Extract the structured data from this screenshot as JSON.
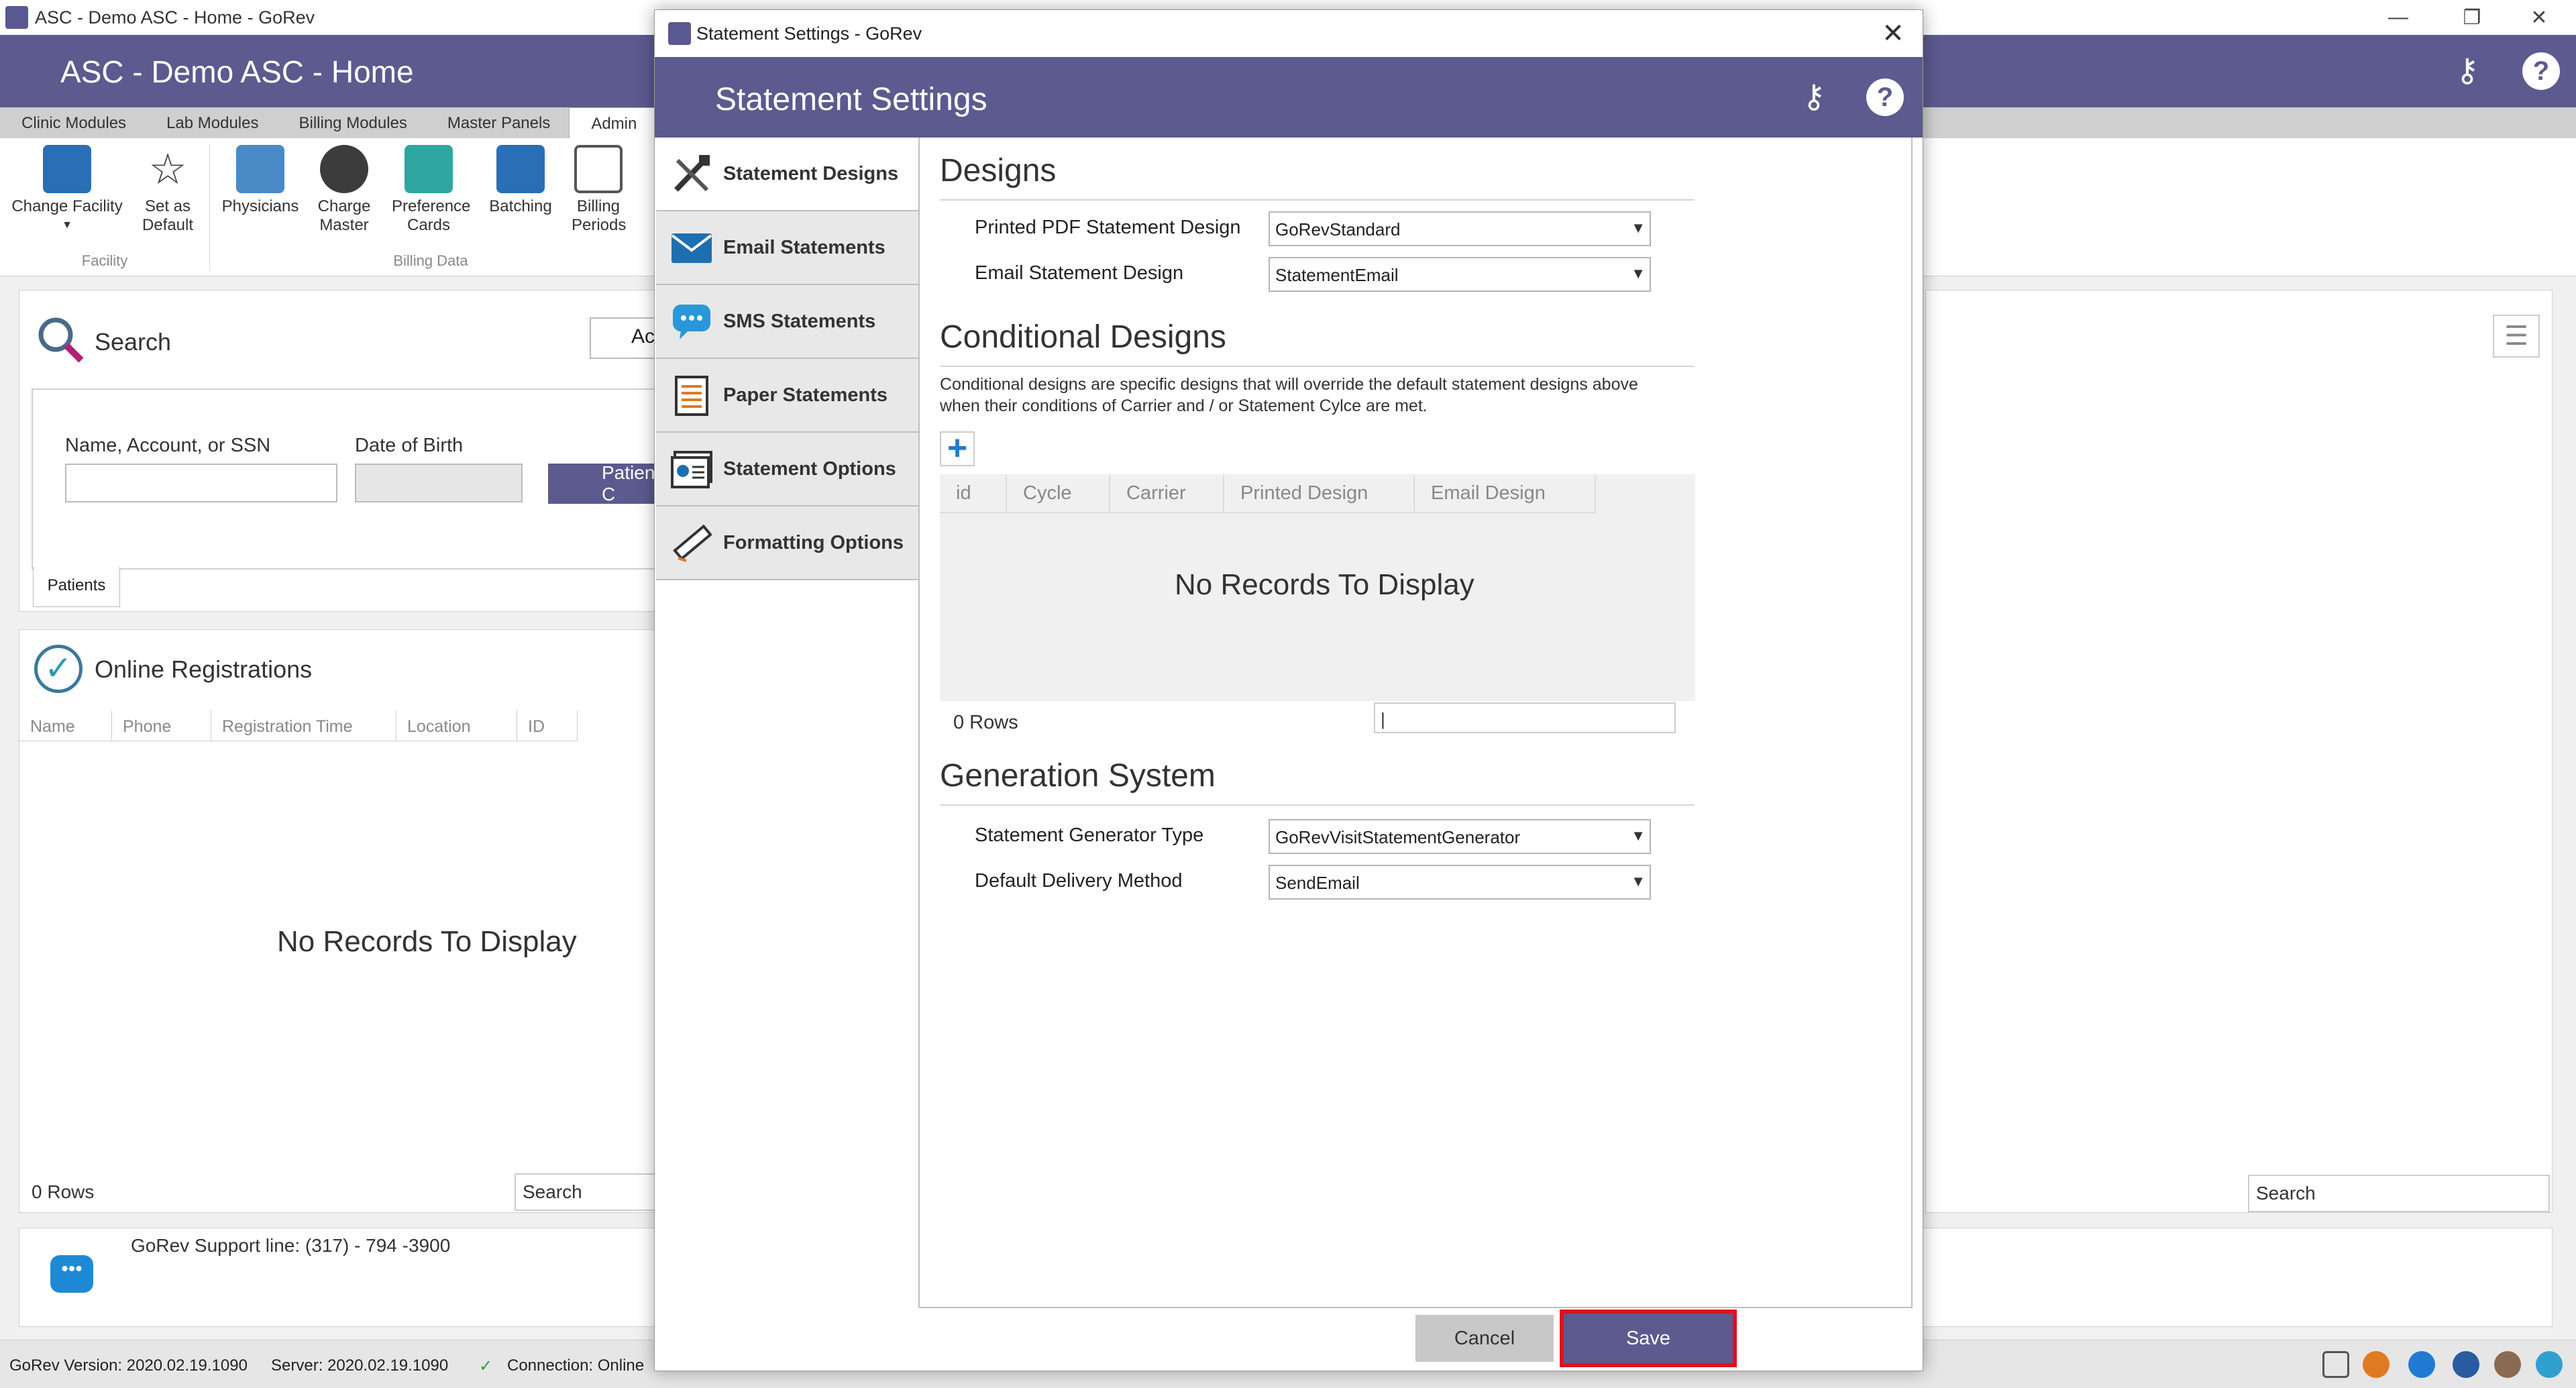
{
  "app": {
    "window_title": "ASC - Demo ASC - Home - GoRev",
    "header_title": "ASC - Demo ASC - Home",
    "ribbon_tabs": [
      "Clinic Modules",
      "Lab Modules",
      "Billing Modules",
      "Master Panels",
      "Admin"
    ],
    "ribbon": {
      "buttons": [
        {
          "label": "Change Facility",
          "icon": "hospital-icon"
        },
        {
          "label": "Set as Default",
          "icon": "star-icon"
        },
        {
          "label": "Physicians",
          "icon": "stethoscope-icon"
        },
        {
          "label": "Charge Master",
          "icon": "dollar-gear-icon"
        },
        {
          "label": "Preference Cards",
          "icon": "cards-icon"
        },
        {
          "label": "Batching",
          "icon": "medical-folder-icon"
        },
        {
          "label": "Billing Periods",
          "icon": "calendar-icon"
        }
      ],
      "groups": [
        "Facility",
        "Billing Data"
      ]
    },
    "search_panel": {
      "title": "Search",
      "name_label": "Name, Account, or SSN",
      "dob_label": "Date of Birth",
      "search_box_text": "Ac",
      "patient_button": "Patient C",
      "tab_label": "Patients"
    },
    "registrations": {
      "title": "Online Registrations",
      "columns": [
        "Name",
        "Phone",
        "Registration Time",
        "Location",
        "ID"
      ],
      "empty_text": "No Records To Display",
      "rows_text": "0 Rows",
      "search_text": "Search"
    },
    "right_panel": {
      "search_text": "Search"
    },
    "support": {
      "text": "GoRev Support line: (317) - 794 -3900"
    },
    "statusbar": {
      "version": "GoRev Version: 2020.02.19.1090",
      "server": "Server: 2020.02.19.1090",
      "connection": "Connection: Online"
    }
  },
  "dialog": {
    "window_title": "Statement Settings - GoRev",
    "header_title": "Statement Settings",
    "nav": [
      {
        "label": "Statement Designs",
        "icon": "tools-icon"
      },
      {
        "label": "Email Statements",
        "icon": "envelope-icon"
      },
      {
        "label": "SMS Statements",
        "icon": "chat-bubble-icon"
      },
      {
        "label": "Paper Statements",
        "icon": "document-icon"
      },
      {
        "label": "Statement Options",
        "icon": "options-card-icon"
      },
      {
        "label": "Formatting Options",
        "icon": "ruler-icon"
      }
    ],
    "designs": {
      "title": "Designs",
      "printed_label": "Printed PDF Statement Design",
      "printed_value": "GoRevStandard",
      "email_label": "Email Statement Design",
      "email_value": "StatementEmail"
    },
    "conditional": {
      "title": "Conditional Designs",
      "description_line1": "Conditional designs are specific designs that will override the default statement designs above",
      "description_line2": "when their conditions of Carrier and / or Statement Cylce are met.",
      "columns": [
        "id",
        "Cycle",
        "Carrier",
        "Printed Design",
        "Email Design"
      ],
      "empty_text": "No Records To Display",
      "rows_text": "0 Rows",
      "search_value": "|"
    },
    "generation": {
      "title": "Generation System",
      "generator_label": "Statement Generator Type",
      "generator_value": "GoRevVisitStatementGenerator",
      "delivery_label": "Default Delivery Method",
      "delivery_value": "SendEmail"
    },
    "buttons": {
      "cancel": "Cancel",
      "save": "Save"
    }
  },
  "colors": {
    "header": "#5c5a8e",
    "highlight": "#e01020",
    "accent_blue": "#1f7bd1"
  }
}
